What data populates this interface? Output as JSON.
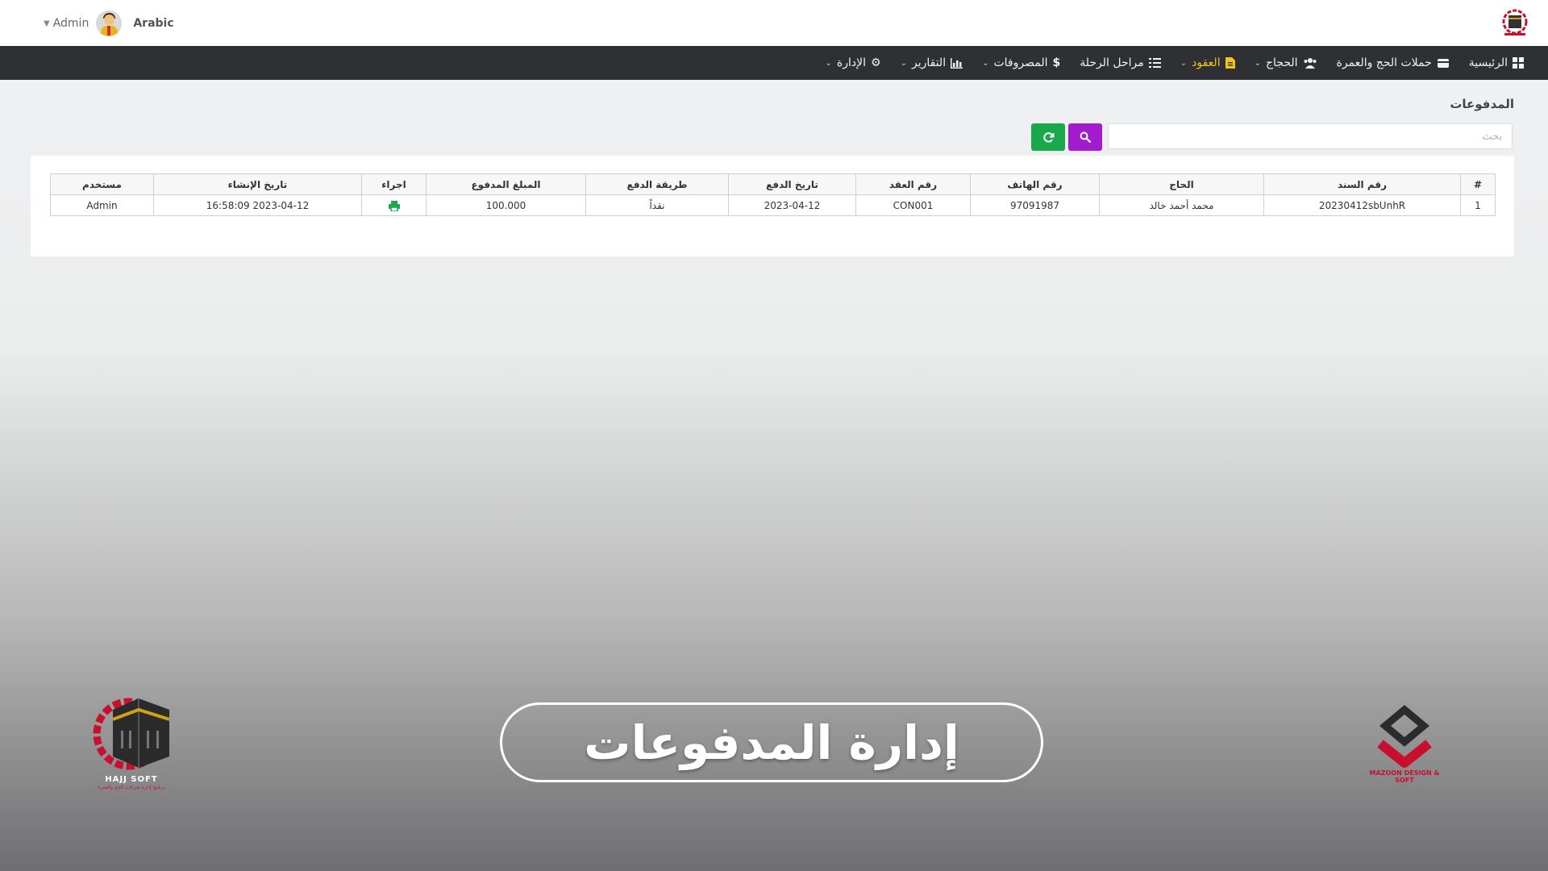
{
  "topbar": {
    "user_name": "Admin",
    "language": "Arabic"
  },
  "nav": {
    "items": [
      {
        "label": "الرئيسية",
        "icon": "dashboard-icon",
        "dropdown": false
      },
      {
        "label": "حملات الحج والعمرة",
        "icon": "kaaba-icon",
        "dropdown": false
      },
      {
        "label": "الحجاج",
        "icon": "users-icon",
        "dropdown": true
      },
      {
        "label": "العقود",
        "icon": "contract-icon",
        "dropdown": true,
        "active": true
      },
      {
        "label": "مراحل الرحلة",
        "icon": "list-icon",
        "dropdown": false
      },
      {
        "label": "المصروفات",
        "icon": "dollar-icon",
        "dropdown": true
      },
      {
        "label": "التقارير",
        "icon": "chart-icon",
        "dropdown": true
      },
      {
        "label": "الإدارة",
        "icon": "gear-icon",
        "dropdown": true
      }
    ],
    "active_color": "#f0c419"
  },
  "page": {
    "title": "المدفوعات",
    "search_placeholder": "بحث"
  },
  "table": {
    "headers": [
      "#",
      "رقم السند",
      "الحاج",
      "رقم الهاتف",
      "رقم العقد",
      "تاريخ الدفع",
      "طريقة الدفع",
      "المبلغ المدفوع",
      "اجراء",
      "تاريخ الإنشاء",
      "مستخدم"
    ],
    "rows": [
      {
        "index": "1",
        "receipt_no": "20230412sbUnhR",
        "pilgrim": "محمد أحمد خالد",
        "phone": "97091987",
        "contract_no": "CON001",
        "payment_date": "2023-04-12",
        "payment_method": "نقداً",
        "amount": "100.000",
        "action_icon": "print-icon",
        "created_at": "2023-04-12 16:58:09",
        "user": "Admin"
      }
    ]
  },
  "banner": {
    "text": "إدارة المدفوعات"
  },
  "logos": {
    "left_caption": "HAJJ SOFT",
    "left_sub": "برنامج إدارة شركات الحج والعمرة",
    "right_caption": "MAZOON DESIGN & SOFT"
  },
  "colors": {
    "navbar": "#2f3033",
    "search_button": "#a21ccf",
    "refresh_button": "#1aa84d",
    "brand_red": "#c8102e"
  }
}
